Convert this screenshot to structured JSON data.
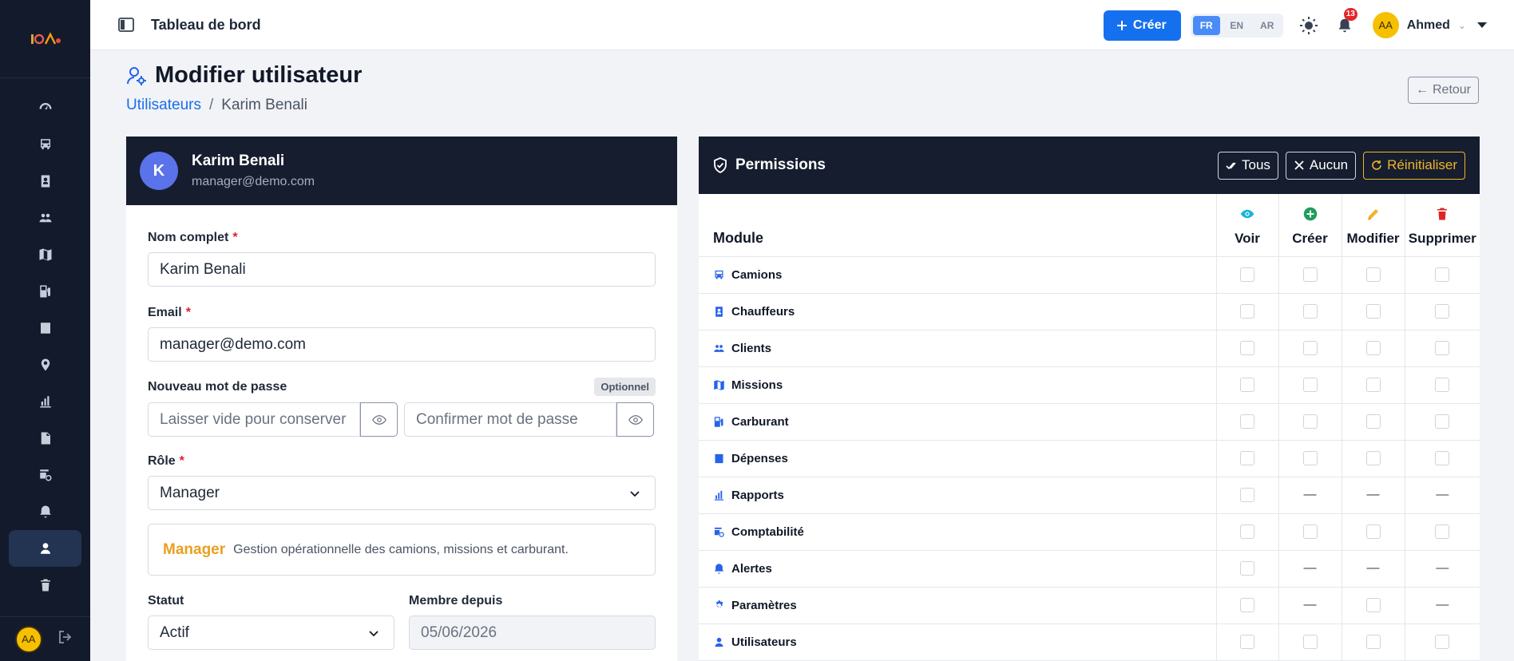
{
  "topbar": {
    "title": "Tableau de bord",
    "create_label": "Créer",
    "languages": [
      "FR",
      "EN",
      "AR"
    ],
    "active_language": "FR",
    "notification_count": "13",
    "user_initials": "AA",
    "user_name": "Ahmed"
  },
  "sidebar": {
    "items": [
      "dashboard-icon",
      "truck-icon",
      "driver-icon",
      "clients-icon",
      "missions-icon",
      "fuel-icon",
      "expenses-icon",
      "location-icon",
      "reports-icon",
      "document-icon",
      "accounting-icon",
      "alerts-icon",
      "user-icon",
      "trash-icon"
    ],
    "active_item": "user-icon",
    "user_initials": "AA"
  },
  "page": {
    "title": "Modifier utilisateur",
    "breadcrumb": {
      "parent": "Utilisateurs",
      "separator": "/",
      "current": "Karim Benali"
    },
    "back_label": "Retour"
  },
  "user_card": {
    "avatar_letter": "K",
    "name": "Karim Benali",
    "email": "manager@demo.com"
  },
  "form": {
    "full_name": {
      "label": "Nom complet",
      "required": "*",
      "value": "Karim Benali"
    },
    "email": {
      "label": "Email",
      "required": "*",
      "value": "manager@demo.com"
    },
    "password": {
      "label": "Nouveau mot de passe",
      "badge": "Optionnel",
      "placeholder": "Laisser vide pour conserver",
      "confirm_placeholder": "Confirmer mot de passe"
    },
    "role": {
      "label": "Rôle",
      "required": "*",
      "value": "Manager"
    },
    "role_info": {
      "name": "Manager",
      "description": "Gestion opérationnelle des camions, missions et carburant."
    },
    "status": {
      "label": "Statut",
      "value": "Actif"
    },
    "member_since": {
      "label": "Membre depuis",
      "value": "05/06/2026"
    }
  },
  "permissions": {
    "title": "Permissions",
    "actions": {
      "all": "Tous",
      "none": "Aucun",
      "reset": "Réinitialiser"
    },
    "module_header": "Module",
    "columns": [
      {
        "label": "Voir",
        "icon": "eye-icon",
        "color": "#17b6d4"
      },
      {
        "label": "Créer",
        "icon": "plus-circle-icon",
        "color": "#1e9e5a"
      },
      {
        "label": "Modifier",
        "icon": "pencil-icon",
        "color": "#f0b429"
      },
      {
        "label": "Supprimer",
        "icon": "trash-icon",
        "color": "#dc2626"
      }
    ],
    "rows": [
      {
        "module": "Camions",
        "icon": "truck-icon",
        "cells": [
          "cb",
          "cb",
          "cb",
          "cb"
        ]
      },
      {
        "module": "Chauffeurs",
        "icon": "driver-icon",
        "cells": [
          "cb",
          "cb",
          "cb",
          "cb"
        ]
      },
      {
        "module": "Clients",
        "icon": "clients-icon",
        "cells": [
          "cb",
          "cb",
          "cb",
          "cb"
        ]
      },
      {
        "module": "Missions",
        "icon": "map-icon",
        "cells": [
          "cb",
          "cb",
          "cb",
          "cb"
        ]
      },
      {
        "module": "Carburant",
        "icon": "fuel-icon",
        "cells": [
          "cb",
          "cb",
          "cb",
          "cb"
        ]
      },
      {
        "module": "Dépenses",
        "icon": "receipt-icon",
        "cells": [
          "cb",
          "cb",
          "cb",
          "cb"
        ]
      },
      {
        "module": "Rapports",
        "icon": "chart-icon",
        "cells": [
          "cb",
          "—",
          "—",
          "—"
        ]
      },
      {
        "module": "Comptabilité",
        "icon": "accounting-icon",
        "cells": [
          "cb",
          "cb",
          "cb",
          "cb"
        ]
      },
      {
        "module": "Alertes",
        "icon": "bell-icon",
        "cells": [
          "cb",
          "—",
          "—",
          "—"
        ]
      },
      {
        "module": "Paramètres",
        "icon": "gear-icon",
        "cells": [
          "cb",
          "—",
          "cb",
          "—"
        ]
      },
      {
        "module": "Utilisateurs",
        "icon": "user-icon",
        "cells": [
          "cb",
          "cb",
          "cb",
          "cb"
        ]
      }
    ]
  }
}
